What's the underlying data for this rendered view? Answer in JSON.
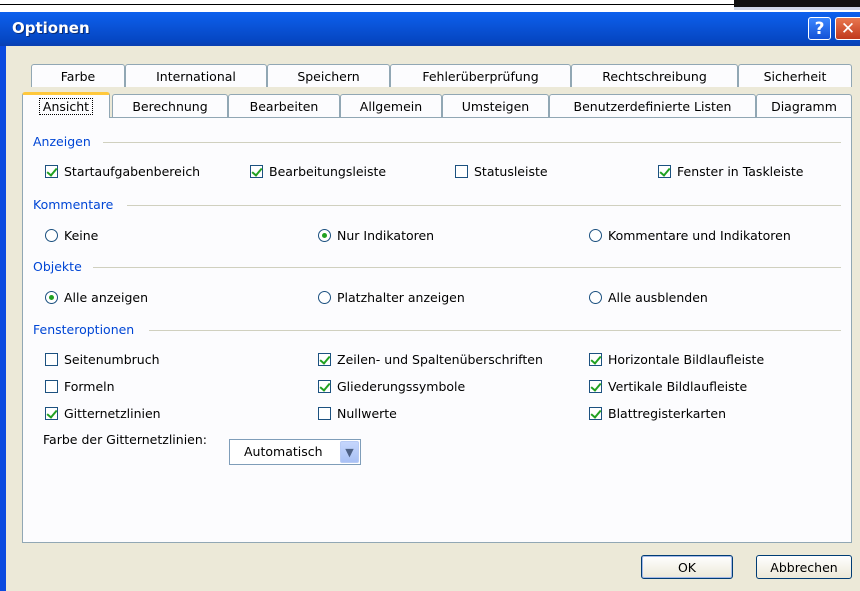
{
  "window": {
    "title": "Optionen"
  },
  "titlebar": {
    "help_glyph": "?",
    "close_glyph": "✕"
  },
  "tabs_row1": [
    "Farbe",
    "International",
    "Speichern",
    "Fehlerüberprüfung",
    "Rechtschreibung",
    "Sicherheit"
  ],
  "tabs_row2": [
    "Ansicht",
    "Berechnung",
    "Bearbeiten",
    "Allgemein",
    "Umsteigen",
    "Benutzerdefinierte Listen",
    "Diagramm"
  ],
  "active_tab": "Ansicht",
  "anzeigen": {
    "title": "Anzeigen",
    "items": [
      {
        "label": "Startaufgabenbereich",
        "checked": true
      },
      {
        "label": "Bearbeitungsleiste",
        "checked": true
      },
      {
        "label": "Statusleiste",
        "checked": false
      },
      {
        "label": "Fenster in Taskleiste",
        "checked": true
      }
    ]
  },
  "kommentare": {
    "title": "Kommentare",
    "items": [
      {
        "label": "Keine",
        "selected": false
      },
      {
        "label": "Nur Indikatoren",
        "selected": true
      },
      {
        "label": "Kommentare und Indikatoren",
        "selected": false
      }
    ]
  },
  "objekte": {
    "title": "Objekte",
    "items": [
      {
        "label": "Alle anzeigen",
        "selected": true
      },
      {
        "label": "Platzhalter anzeigen",
        "selected": false
      },
      {
        "label": "Alle ausblenden",
        "selected": false
      }
    ]
  },
  "fensteroptionen": {
    "title": "Fensteroptionen",
    "items": [
      {
        "label": "Seitenumbruch",
        "checked": false
      },
      {
        "label": "Zeilen- und Spaltenüberschriften",
        "checked": true
      },
      {
        "label": "Horizontale Bildlaufleiste",
        "checked": true
      },
      {
        "label": "Formeln",
        "checked": false
      },
      {
        "label": "Gliederungssymbole",
        "checked": true
      },
      {
        "label": "Vertikale Bildlaufleiste",
        "checked": true
      },
      {
        "label": "Gitternetzlinien",
        "checked": true
      },
      {
        "label": "Nullwerte",
        "checked": false
      },
      {
        "label": "Blattregisterkarten",
        "checked": true
      }
    ],
    "gridcolor_label": "Farbe der Gitternetzlinien:",
    "gridcolor_value": "Automatisch"
  },
  "buttons": {
    "ok": "OK",
    "cancel": "Abbrechen"
  },
  "colors": {
    "accent": "#0046d5",
    "titlebar": "#0a54d9",
    "check": "#21a121"
  }
}
